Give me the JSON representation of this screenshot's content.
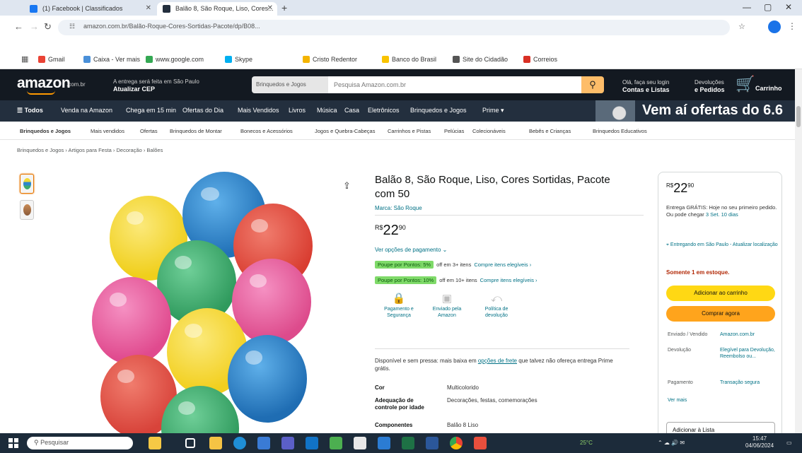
{
  "browser": {
    "tabs": [
      {
        "label": "(1) Facebook | Classificados"
      },
      {
        "label": "Balão 8, São Roque, Liso, Cores..."
      }
    ],
    "url": "amazon.com.br/Balão-Roque-Cores-Sortidas-Pacote/dp/B08...",
    "bookmarks": [
      "Gmail",
      "Caixa - Ver mais",
      "www.google.com",
      "Skype",
      "Cristo Redentor",
      "Banco do Brasil",
      "Site do Cidadão",
      "Correios"
    ]
  },
  "amazon": {
    "logo": "amazon",
    "logo_suffix": ".com.br",
    "deliver_line1": "A entrega será feita em São Paulo",
    "deliver_line2": "Atualizar CEP",
    "search_category": "Brinquedos e Jogos",
    "search_placeholder": "Pesquisa Amazon.com.br",
    "account_line1": "Olá, faça seu login",
    "account_line2": "Contas e Listas",
    "orders_line1": "Devoluções",
    "orders_line2": "e Pedidos",
    "cart_label": "Carrinho",
    "nav": [
      "Todos",
      "Venda na Amazon",
      "Chega em 15 min",
      "Ofertas do Dia",
      "Mais Vendidos",
      "Livros",
      "Música",
      "Casa",
      "Eletrônicos",
      "Brinquedos e Jogos",
      "Prime"
    ],
    "promo": "Vem aí ofertas do 6.6",
    "subnav": [
      "Brinquedos e Jogos",
      "Mais vendidos",
      "Ofertas",
      "Brinquedos de Montar",
      "Bonecos e Acessórios",
      "Jogos e Quebra-Cabeças",
      "Carrinhos e Pistas",
      "Pelúcias",
      "Colecionáveis",
      "Bebês e Crianças",
      "Brinquedos Educativos"
    ],
    "breadcrumb": "Brinquedos e Jogos › Artigos para Festa › Decoração › Balões"
  },
  "product": {
    "title": "Balão 8, São Roque, Liso, Cores Sortidas, Pacote com 50",
    "brand": "Marca: São Roque",
    "price_symbol": "R$",
    "price_whole": "22",
    "price_cents": "90",
    "payment_link": "Ver opções de pagamento ⌄",
    "deals": [
      {
        "badge": "Poupe por Pontos: 5%",
        "text": "off em 3+ itens",
        "link": "Compre itens elegíveis ›"
      },
      {
        "badge": "Poupe por Pontos: 10%",
        "text": "off em 10+ itens",
        "link": "Compre itens elegíveis ›"
      }
    ],
    "features": [
      {
        "label": "Pagamento e Segurança"
      },
      {
        "label": "Enviado pela Amazon"
      },
      {
        "label": "Política de devolução"
      }
    ],
    "availability": "Disponível e sem pressa: mais baixa em",
    "availability_link": "opções de frete",
    "availability_rest": "que talvez não ofereça entrega Prime grátis.",
    "specs": [
      {
        "key": "Cor",
        "value": "Multicolorido"
      },
      {
        "key": "Adequação de controle por idade",
        "value": "Decorações, festas, comemorações"
      },
      {
        "key": "Componentes",
        "value": "Balão 8 Liso"
      }
    ],
    "balloon_colors": [
      "#f2d936",
      "#2d86cc",
      "#e04a3e",
      "#3daa6d",
      "#e8579a",
      "#e8579a",
      "#f6d834",
      "#2a7fc2",
      "#df4d45",
      "#3fae70"
    ]
  },
  "buybox": {
    "price_symbol": "R$",
    "price_whole": "22",
    "price_cents": "90",
    "delivery_text": "Entrega GRÁTIS: Hoje no seu primeiro pedido. Ou pode chegar",
    "delivery_date": "3 Set. 10 dias",
    "location": "Entregando em São Paulo - Atualizar localização",
    "stock": "Somente 1 em estoque.",
    "add_to_cart": "Adicionar ao carrinho",
    "buy_now": "Comprar agora",
    "rows": [
      {
        "key": "Enviado / Vendido",
        "value": "Amazon.com.br"
      },
      {
        "key": "Devolução",
        "value": "Elegível para Devolução, Reembolso ou..."
      },
      {
        "key": "Pagamento",
        "value": "Transação segura"
      }
    ],
    "see_more": "Ver mais",
    "add_to_list": "Adicionar à Lista"
  },
  "taskbar": {
    "search_placeholder": "Pesquisar",
    "weather": "25°C",
    "clock": "15:47",
    "date": "04/06/2024"
  }
}
